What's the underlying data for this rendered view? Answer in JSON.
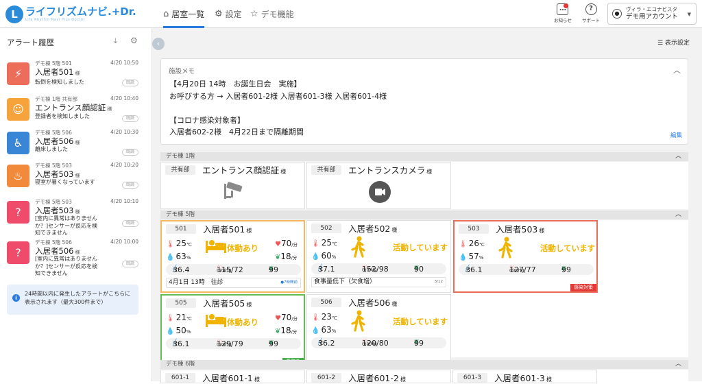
{
  "header": {
    "logo_mark": "L",
    "logo_text": "ライフリズムナビ.+Dr.",
    "logo_tagline": "Life Rhythm Navi Plus Doctor",
    "nav": [
      {
        "label": "居室一覧",
        "icon": "home-icon",
        "active": true
      },
      {
        "label": "設定",
        "icon": "gear-icon",
        "active": false
      },
      {
        "label": "デモ機能",
        "icon": "star-icon",
        "active": false
      }
    ],
    "news_label": "お知らせ",
    "support_label": "サポート",
    "account_line1": "ヴィラ・エコナビスタ",
    "account_line2": "デモ用アカウント"
  },
  "sidebar": {
    "title": "アラート履歴",
    "alerts": [
      {
        "location": "デモ棟 5階 501",
        "time": "4/20 10:50",
        "name": "入居者501",
        "honorific": "様",
        "message": "転倒を検知しました",
        "read": "既読",
        "icon": "fall-icon",
        "color": "#ec6e5a"
      },
      {
        "location": "デモ棟 1階 共有部",
        "time": "4/20 10:40",
        "name": "エントランス顔認証",
        "honorific": "様",
        "message": "登録者を検知しました",
        "read": "既読",
        "icon": "face-icon",
        "color": "#f5a33a"
      },
      {
        "location": "デモ棟 5階 506",
        "time": "4/20 10:30",
        "name": "入居者506",
        "honorific": "様",
        "message": "離床しました",
        "read": "既読",
        "icon": "bed-exit-icon",
        "color": "#3a86d6"
      },
      {
        "location": "デモ棟 5階 503",
        "time": "4/20 10:20",
        "name": "入居者503",
        "honorific": "様",
        "message": "寝室が暑くなっています",
        "read": "既読",
        "icon": "heat-icon",
        "color": "#f28a3c"
      },
      {
        "location": "デモ棟 5階 503",
        "time": "4/20 10:10",
        "name": "入居者503",
        "honorific": "様",
        "message": "[室内に異常はありませんか？]センサーが反応を検知できません",
        "read": "既読",
        "icon": "unknown-person-icon",
        "color": "#ee4c6a"
      },
      {
        "location": "デモ棟 5階 506",
        "time": "4/20 10:00",
        "name": "入居者506",
        "honorific": "様",
        "message": "[室内に異常はありませんか？]センサーが反応を検知できません",
        "read": "既読",
        "icon": "unknown-person-icon",
        "color": "#ee4c6a"
      }
    ],
    "info": "24時間以内に発生したアラートがこちらに表示されます（最大300件まで）"
  },
  "main": {
    "display_settings": "表示設定",
    "memo": {
      "title": "施設メモ",
      "body": "【4月20日 14時　お誕生日会　実施】\nお呼びする方 → 入居者601-2様 入居者601-3様 入居者601-4様\n\n【コロナ感染対象者】\n入居者602-2様　4月22日まで隔離期間",
      "edit": "編集"
    },
    "sections": [
      "デモ棟 1階",
      "デモ棟 5階",
      "デモ棟 6階"
    ],
    "floor1": [
      {
        "room": "共有部",
        "name": "エントランス顔認証",
        "honorific": "様",
        "icon": "security-camera-icon"
      },
      {
        "room": "共有部",
        "name": "エントランスカメラ",
        "honorific": "様",
        "icon": "video-camera-icon"
      }
    ],
    "floor5": [
      {
        "room": "501",
        "name": "入居者501",
        "honorific": "様",
        "temp": "25",
        "hum": "63",
        "status": "体動あり",
        "pic": "person-in-bed-icon",
        "hr": "70",
        "rr": "18",
        "bt": "36.4",
        "bp": "115/72",
        "spo2": "99",
        "note": "4月1日 13時　往診",
        "note_extra": "●7時間前",
        "border": "#f5b860",
        "tag": "",
        "tagcolor": ""
      },
      {
        "room": "502",
        "name": "入居者502",
        "honorific": "様",
        "temp": "25",
        "hum": "60",
        "status": "活動しています",
        "pic": "walking-person-icon",
        "hr": "",
        "rr": "",
        "bt": "37.1",
        "bp": "152/98",
        "spo2": "90",
        "note": "食事量低下（欠食増）",
        "note_extra": "3/12",
        "border": "#e0e0e0",
        "tag": "",
        "tagcolor": ""
      },
      {
        "room": "503",
        "name": "入居者503",
        "honorific": "様",
        "temp": "26",
        "hum": "57",
        "status": "活動しています",
        "pic": "walking-person-icon",
        "hr": "",
        "rr": "",
        "bt": "36.1",
        "bp": "127/77",
        "spo2": "99",
        "note": "",
        "note_extra": "",
        "border": "#e96e5a",
        "tag": "感染対策",
        "tagcolor": "#e53935"
      },
      {
        "room": "505",
        "name": "入居者505",
        "honorific": "様",
        "temp": "21",
        "hum": "50",
        "status": "体動あり",
        "pic": "person-in-bed-icon",
        "hr": "70",
        "rr": "18",
        "bt": "36.1",
        "bp": "129/79",
        "spo2": "99",
        "note": "",
        "note_extra": "",
        "border": "#66bb55",
        "tag": "看取り",
        "tagcolor": "#4caf50"
      },
      {
        "room": "506",
        "name": "入居者506",
        "honorific": "様",
        "temp": "23",
        "hum": "63",
        "status": "活動しています",
        "pic": "walking-person-icon",
        "hr": "",
        "rr": "",
        "bt": "36.2",
        "bp": "120/80",
        "spo2": "99",
        "note": "",
        "note_extra": "",
        "border": "#e0e0e0",
        "tag": "",
        "tagcolor": ""
      }
    ],
    "floor6": [
      {
        "room": "601-1",
        "name": "入居者601-1",
        "honorific": "様"
      },
      {
        "room": "601-2",
        "name": "入居者601-2",
        "honorific": "様"
      },
      {
        "room": "601-3",
        "name": "入居者601-3",
        "honorific": "様"
      }
    ],
    "units": {
      "temp": "℃",
      "hum": "%",
      "hr": "/分",
      "rr": "/分",
      "bt": "℃",
      "bp": "mmHg",
      "spo2": "%"
    }
  }
}
